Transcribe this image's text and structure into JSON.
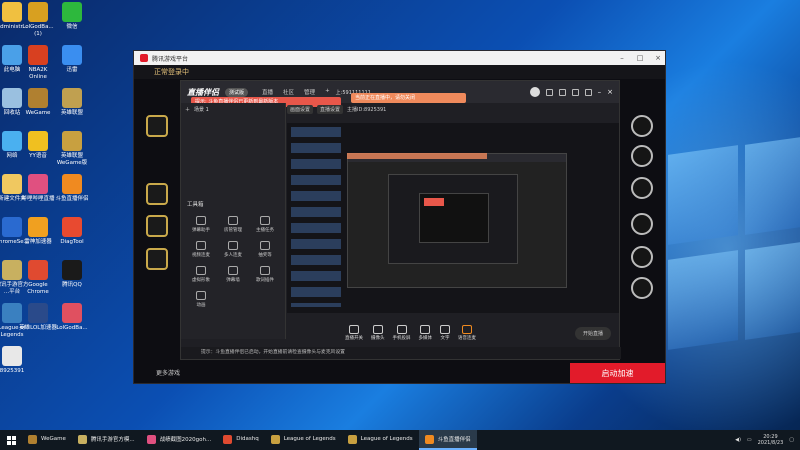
{
  "desktop": {
    "icons": [
      {
        "label": "Administr...",
        "color": "#f0c040"
      },
      {
        "label": "LolGodBa...\n(1)",
        "color": "#d8a020"
      },
      {
        "label": "微信",
        "color": "#2db83d"
      },
      {
        "label": "此电脑",
        "color": "#4aa0e8"
      },
      {
        "label": "NBA2K\nOnline",
        "color": "#d84020"
      },
      {
        "label": "迅雷",
        "color": "#3a8ef0"
      },
      {
        "label": "回收站",
        "color": "#9ac0e0"
      },
      {
        "label": "WeGame",
        "color": "#b08030"
      },
      {
        "label": "英雄联盟",
        "color": "#c0a050"
      },
      {
        "label": "网络",
        "color": "#4ab0f0"
      },
      {
        "label": "YY语音",
        "color": "#f0c020"
      },
      {
        "label": "英雄联盟\nWeGame版",
        "color": "#c8a040"
      },
      {
        "label": "新建文件夹",
        "color": "#f0c860"
      },
      {
        "label": "哔哩哔哩直播",
        "color": "#e05080"
      },
      {
        "label": "斗鱼直播伴侣",
        "color": "#f08a20"
      },
      {
        "label": "ChromeSe...",
        "color": "#2a6ad0"
      },
      {
        "label": "雷神加速器",
        "color": "#f0a020"
      },
      {
        "label": "DiagTool",
        "color": "#e84a30"
      },
      {
        "label": "腾讯手游官方\n...平台",
        "color": "#c8b060"
      },
      {
        "label": "Google\nChrome",
        "color": "#e04a30"
      },
      {
        "label": "腾讯QQ",
        "color": "#1a1a1a"
      },
      {
        "label": "League of\nLegends",
        "color": "#3a80c0"
      },
      {
        "label": "英雄LOL加速器",
        "color": "#2a4a8a"
      },
      {
        "label": "LolGodBa...",
        "color": "#e05060"
      },
      {
        "label": "8925391",
        "color": "#e8e8e8"
      }
    ],
    "watermark_id": "8925391"
  },
  "taskbar": {
    "items": [
      {
        "label": "WeGame",
        "active": false,
        "color": "#b08030"
      },
      {
        "label": "腾讯手游官方模...",
        "active": false,
        "color": "#c8b060"
      },
      {
        "label": "战绩截图2020goh...",
        "active": false,
        "color": "#e05080"
      },
      {
        "label": "Didashq",
        "active": false,
        "color": "#e04a30"
      },
      {
        "label": "League of Legends",
        "active": false,
        "color": "#c8a040"
      },
      {
        "label": "League of Legends",
        "active": false,
        "color": "#c8a040"
      },
      {
        "label": "斗鱼直播伴侣",
        "active": true,
        "color": "#f08a20"
      }
    ],
    "time": "20:29",
    "date": "2021/8/23"
  },
  "game_window": {
    "title": "腾讯游戏平台",
    "header": "正常登录中",
    "accelerate_button": "启动加速",
    "footer_left": "更多游戏",
    "accent": "#e21b2a"
  },
  "stream_app": {
    "logo": "直播伴侣",
    "badge": "测试版",
    "menu": [
      "直播",
      "社区",
      "管理",
      "+"
    ],
    "room_id_label": "上:591111111",
    "notice1": "提示: 斗鱼直播伴侣已更新到最新版本",
    "notice2": "当前正在直播中，请勿关闭",
    "scene_label": "场景 1",
    "tabs": [
      "画面设置",
      "直播设置",
      "主播ID:8925391"
    ],
    "tools_label": "工具箱",
    "tools": [
      "弹幕助手",
      "房管管理",
      "主播任务",
      "视频连麦",
      "多人连麦",
      "抽奖等",
      "虚拟形象",
      "弹幕墙",
      "歌词插件",
      "动画"
    ],
    "bottom_buttons": [
      "直播开关",
      "摄像头",
      "手机投屏",
      "多媒体",
      "文字",
      "语音连麦"
    ],
    "start_live": "开始直播",
    "status": "提示：斗鱼直播伴侣已启动，开始直播前请检查摄像头与麦克风设置"
  }
}
